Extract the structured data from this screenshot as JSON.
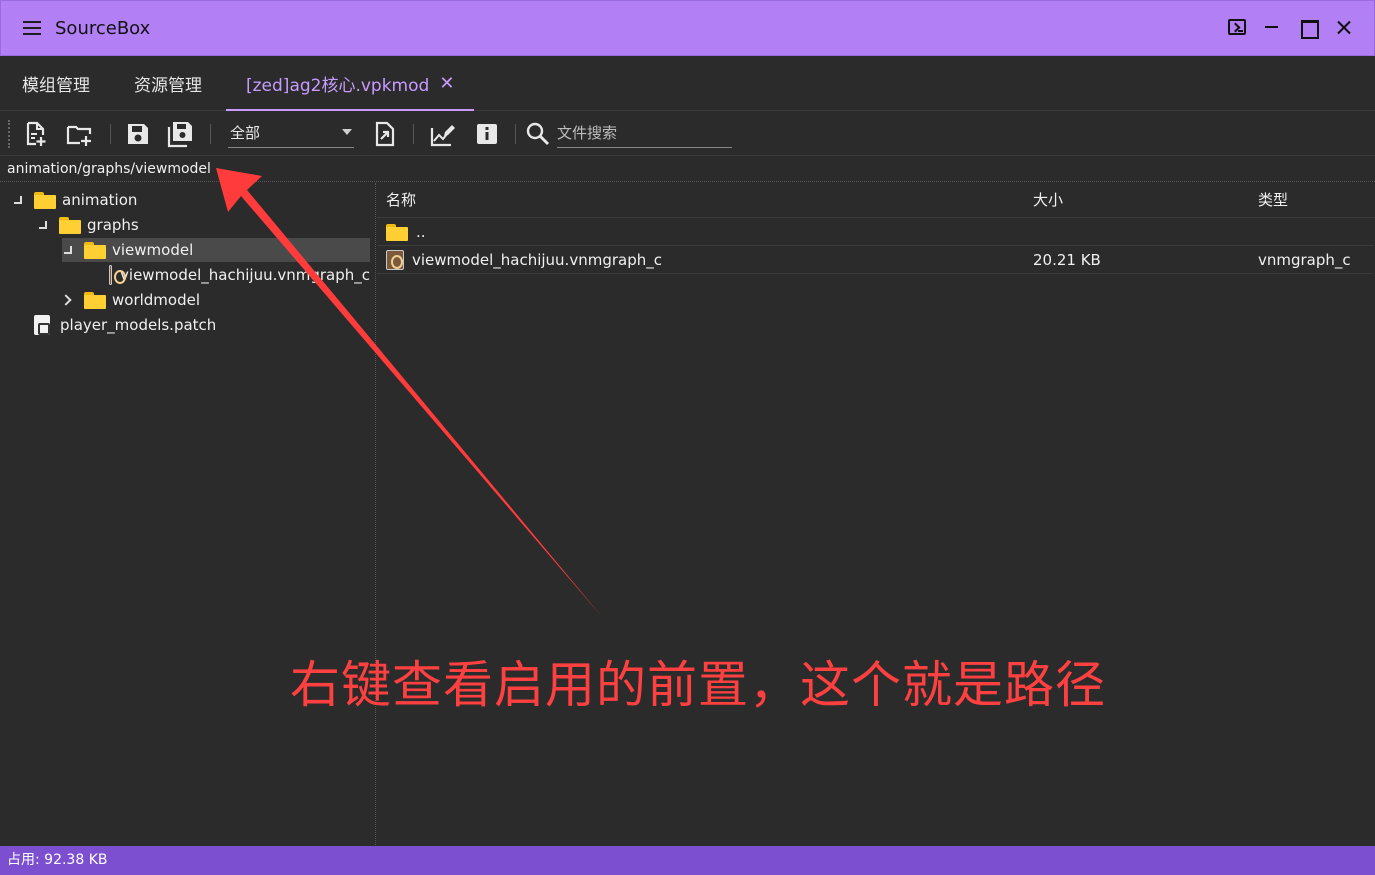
{
  "window": {
    "title": "SourceBox",
    "controls": [
      "terminal-icon",
      "minimize-icon",
      "maximize-icon",
      "close-icon"
    ]
  },
  "tabs": [
    {
      "label": "模组管理",
      "active": false
    },
    {
      "label": "资源管理",
      "active": false
    },
    {
      "label": "[zed]ag2核心.vpkmod",
      "active": true,
      "close": "✕"
    }
  ],
  "toolbar": {
    "icons": [
      "new-file-icon",
      "new-folder-icon",
      "save-icon",
      "save-all-icon",
      "export-icon",
      "edit-image-icon",
      "info-icon",
      "search-icon"
    ],
    "filter_selected": "全部",
    "search_placeholder": "文件搜索"
  },
  "path": "animation/graphs/viewmodel",
  "tree": [
    {
      "label": "animation",
      "level": 0,
      "type": "folder",
      "expander": "open"
    },
    {
      "label": "graphs",
      "level": 1,
      "type": "folder",
      "expander": "open"
    },
    {
      "label": "viewmodel",
      "level": 2,
      "type": "folder",
      "expander": "open",
      "selected": true
    },
    {
      "label": "viewmodel_hachijuu.vnmgraph_c",
      "level": 3,
      "type": "graph"
    },
    {
      "label": "worldmodel",
      "level": 2,
      "type": "folder",
      "expander": "closed"
    },
    {
      "label": "player_models.patch",
      "level": 0,
      "type": "patch"
    }
  ],
  "list": {
    "columns": [
      "名称",
      "大小",
      "类型"
    ],
    "rows": [
      {
        "name": "..",
        "size": "",
        "type": "",
        "icon": "folder"
      },
      {
        "name": "viewmodel_hachijuu.vnmgraph_c",
        "size": "20.21 KB",
        "type": "vnmgraph_c",
        "icon": "graph"
      }
    ]
  },
  "annotation": {
    "text": "右键查看启用的前置，这个就是路径",
    "color": "#ff3b3b"
  },
  "status": {
    "text": "占用: 92.38 KB"
  },
  "colors": {
    "titlebar": "#b27ff5",
    "accent": "#c89bff",
    "statusbar": "#7b4fd0",
    "background": "#2b2b2b"
  }
}
